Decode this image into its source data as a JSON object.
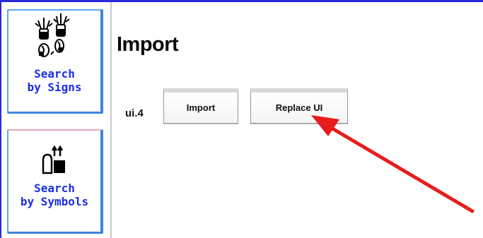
{
  "sidebar": {
    "items": [
      {
        "label_line1": "Search",
        "label_line2": "by Signs",
        "icon": "hand-signs-icon"
      },
      {
        "label_line1": "Search",
        "label_line2": "by Symbols",
        "icon": "symbols-icon"
      }
    ]
  },
  "main": {
    "title": "Import",
    "ui_label": "ui.4",
    "buttons": {
      "import_label": "Import",
      "replace_label": "Replace UI"
    }
  },
  "annotation": {
    "arrow_color": "#e81c1c",
    "arrow_icon": "red-arrow-icon"
  },
  "colors": {
    "frame_border": "#2a2ad8",
    "sidebar_label": "#1a2ee8",
    "sidebar_button_border": "#3d86dc"
  }
}
